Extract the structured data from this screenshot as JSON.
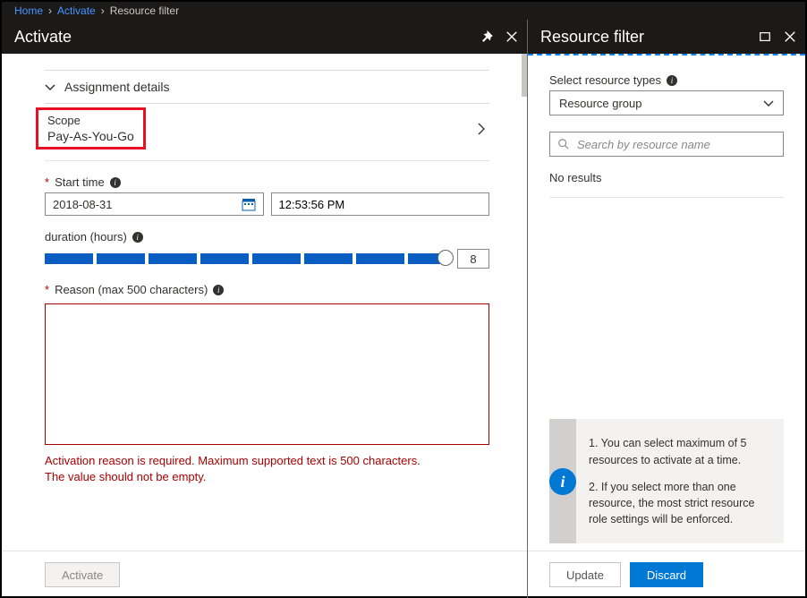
{
  "breadcrumb": {
    "home": "Home",
    "activate": "Activate",
    "current": "Resource filter"
  },
  "main": {
    "title": "Activate",
    "section_header": "Assignment details",
    "scope": {
      "label": "Scope",
      "value": "Pay-As-You-Go"
    },
    "start_time": {
      "label": "Start time",
      "date": "2018-08-31",
      "time": "12:53:56 PM"
    },
    "duration": {
      "label": "duration (hours)",
      "value": "8"
    },
    "reason": {
      "label": "Reason (max 500 characters)",
      "error1": "Activation reason is required. Maximum supported text is 500 characters.",
      "error2": "The value should not be empty."
    },
    "activate_btn": "Activate"
  },
  "side": {
    "title": "Resource filter",
    "select_label": "Select resource types",
    "select_value": "Resource group",
    "search_placeholder": "Search by resource name",
    "no_results": "No results",
    "info1": "1. You can select maximum of 5 resources to activate at a time.",
    "info2": "2. If you select more than one resource, the most strict resource role settings will be enforced.",
    "update_btn": "Update",
    "discard_btn": "Discard"
  }
}
